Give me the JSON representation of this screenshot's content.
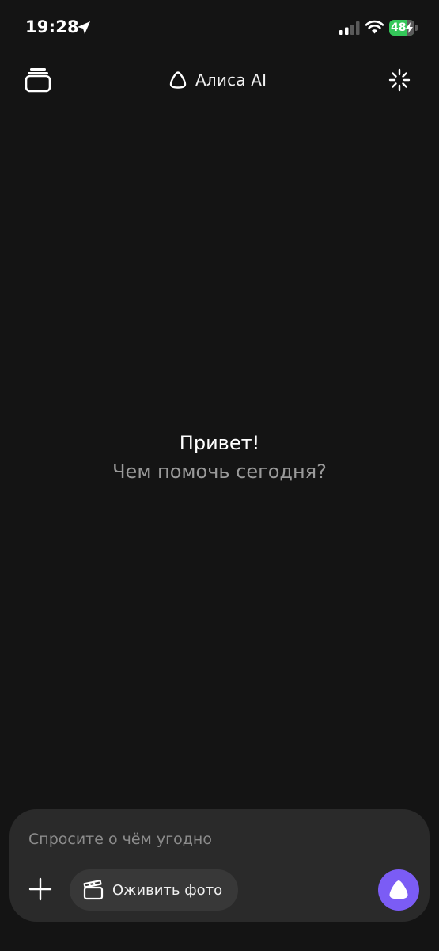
{
  "status_bar": {
    "time": "19:28",
    "battery_percent": "48",
    "battery_color": "#34c759"
  },
  "header": {
    "title": "Алиса AI",
    "left_icon": "stack-icon",
    "right_icon": "sparkle-icon"
  },
  "greeting": {
    "title": "Привет!",
    "subtitle": "Чем помочь сегодня?"
  },
  "composer": {
    "placeholder": "Спросите о чём угодно",
    "value": "",
    "chip_label": "Оживить фото",
    "accent_color": "#7b5cf5"
  }
}
